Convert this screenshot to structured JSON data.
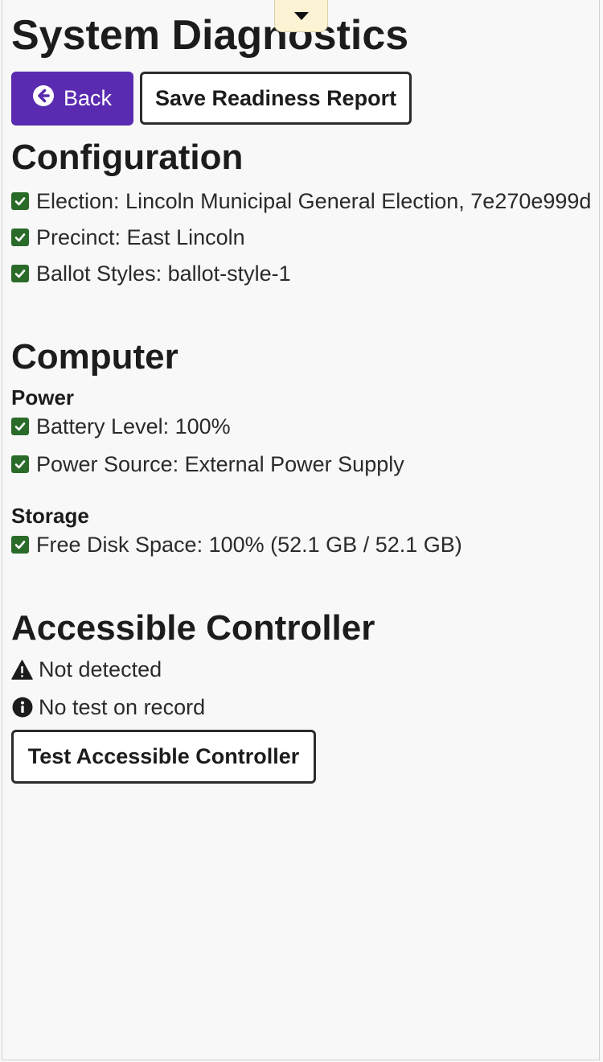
{
  "page": {
    "title": "System Diagnostics"
  },
  "toolbar": {
    "back_label": "Back",
    "save_report_label": "Save Readiness Report"
  },
  "configuration": {
    "heading": "Configuration",
    "items": [
      {
        "label": "Election: Lincoln Municipal General Election, 7e270e999d",
        "status": "ok"
      },
      {
        "label": "Precinct: East Lincoln",
        "status": "ok"
      },
      {
        "label": "Ballot Styles: ballot-style-1",
        "status": "ok"
      }
    ]
  },
  "computer": {
    "heading": "Computer",
    "power": {
      "heading": "Power",
      "items": [
        {
          "label": "Battery Level: 100%",
          "status": "ok"
        },
        {
          "label": "Power Source: External Power Supply",
          "status": "ok"
        }
      ]
    },
    "storage": {
      "heading": "Storage",
      "items": [
        {
          "label": "Free Disk Space: 100% (52.1 GB / 52.1 GB)",
          "status": "ok"
        }
      ]
    }
  },
  "accessible_controller": {
    "heading": "Accessible Controller",
    "detection_status": "Not detected",
    "test_status": "No test on record",
    "test_button_label": "Test Accessible Controller"
  },
  "colors": {
    "primary_button": "#5a2bb0",
    "success_check": "#2a6b2a",
    "dropdown_tab": "#fbf3d4",
    "background": "#f8f8f8"
  },
  "icons": {
    "back": "circle-arrow-left-icon",
    "check": "checkbox-checked-icon",
    "warning": "warning-triangle-icon",
    "info": "info-circle-icon",
    "dropdown": "caret-down-icon"
  }
}
